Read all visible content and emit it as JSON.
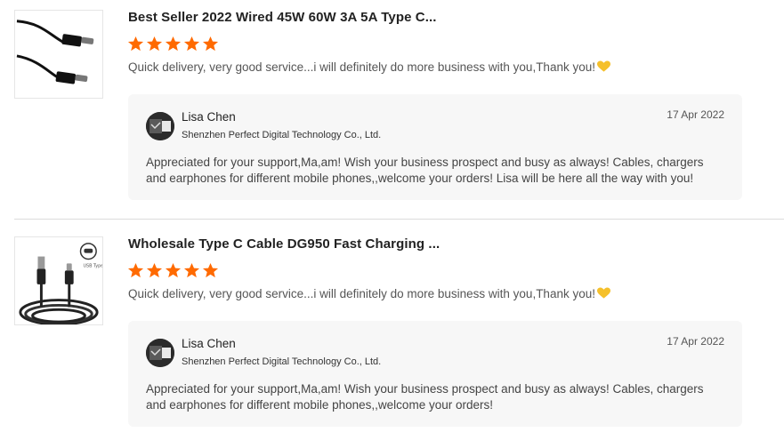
{
  "colors": {
    "star": "#ff6a00",
    "heart": "#f5c02b",
    "reply_bg": "#f7f7f7"
  },
  "reviews": [
    {
      "product_title": "Best Seller 2022 Wired 45W 60W 3A 5A Type C...",
      "rating": 5,
      "comment": "Quick delivery, very good service...i will definitely do more business with you,Thank you!",
      "comment_icon": "yellow-heart-icon",
      "reply": {
        "seller_name": "Lisa Chen",
        "company": "Shenzhen Perfect Digital Technology Co., Ltd.",
        "date": "17 Apr 2022",
        "text": "Appreciated for your support,Ma,am! Wish your business prospect and busy as always! Cables, chargers and earphones for different mobile phones,,welcome your orders! Lisa will be here all the way with you!"
      }
    },
    {
      "product_title": "Wholesale Type C Cable DG950 Fast Charging ...",
      "rating": 5,
      "comment": "Quick delivery, very good service...i will definitely do more business with you,Thank you!",
      "comment_icon": "yellow-heart-icon",
      "reply": {
        "seller_name": "Lisa Chen",
        "company": "Shenzhen Perfect Digital Technology Co., Ltd.",
        "date": "17 Apr 2022",
        "text": "Appreciated for your support,Ma,am! Wish your business prospect and busy as always! Cables, chargers and earphones for different mobile phones,,welcome your orders!"
      }
    }
  ]
}
